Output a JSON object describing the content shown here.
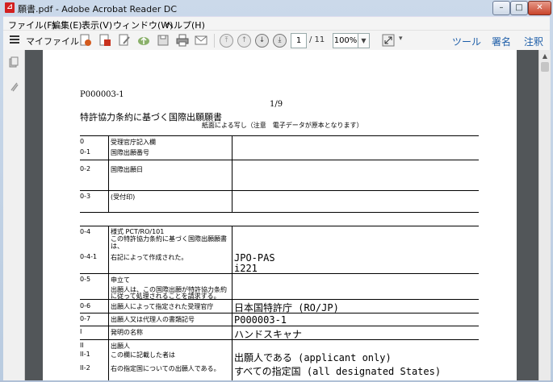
{
  "window": {
    "title": "願書.pdf - Adobe Acrobat Reader DC",
    "pdf_icon": "pdf-icon"
  },
  "window_controls": {
    "minimize": "–",
    "maximize": "□",
    "close": "✕"
  },
  "menu": [
    "ファイル(F)",
    "編集(E)",
    "表示(V)",
    "ウィンドウ(W)",
    "ヘルプ(H)"
  ],
  "toolbar": {
    "my_file_label": "マイファイル",
    "page_current": "1",
    "page_total": "/ 11",
    "zoom": "100%",
    "tools_label": "ツール",
    "sign_label": "署名",
    "comment_label": "注釈"
  },
  "document": {
    "ref_number": "P000003-1",
    "page_indicator": "1/9",
    "heading": "特許協力条約に基づく国際出願願書",
    "subheading": "紙面による写し（注意　電子データが原本となります）",
    "rows": [
      {
        "num": "0",
        "label": "受理官庁記入欄",
        "value": ""
      },
      {
        "num": "0-1",
        "label": "国際出願番号",
        "value": ""
      },
      {
        "num": "0-2",
        "label": "国際出願日",
        "value": ""
      },
      {
        "num": "0-3",
        "label": "(受付印)",
        "value": ""
      },
      {
        "num": "0-4",
        "label": "様式 PCT/RO/101",
        "label2": "この特許協力条約に基づく国際出願願書",
        "label3": "は、",
        "value": ""
      },
      {
        "num": "0-4-1",
        "label": "右記によって作成された。",
        "value": "JPO-PAS",
        "value2": "i221"
      },
      {
        "num": "0-5",
        "label": "申立て",
        "label2": "出願人は、この国際出願が特許協力条約",
        "label3": "に従って処理されることを請求する。",
        "value": ""
      },
      {
        "num": "0-6",
        "label": "出願人によって指定された受理官庁",
        "value": "日本国特許庁 (RO/JP)"
      },
      {
        "num": "0-7",
        "label": "出願人又は代理人の書類記号",
        "value": "P000003-1"
      },
      {
        "num": "I",
        "label": "発明の名称",
        "value": "ハンドスキャナ"
      },
      {
        "num": "II",
        "label": "出願人",
        "value": ""
      },
      {
        "num": "II-1",
        "label": "この欄に記載した者は",
        "value": "出願人である (applicant only)"
      },
      {
        "num": "II-2",
        "label": "右の指定国についての出願人である。",
        "value": "すべての指定国 (all designated States)"
      }
    ]
  }
}
